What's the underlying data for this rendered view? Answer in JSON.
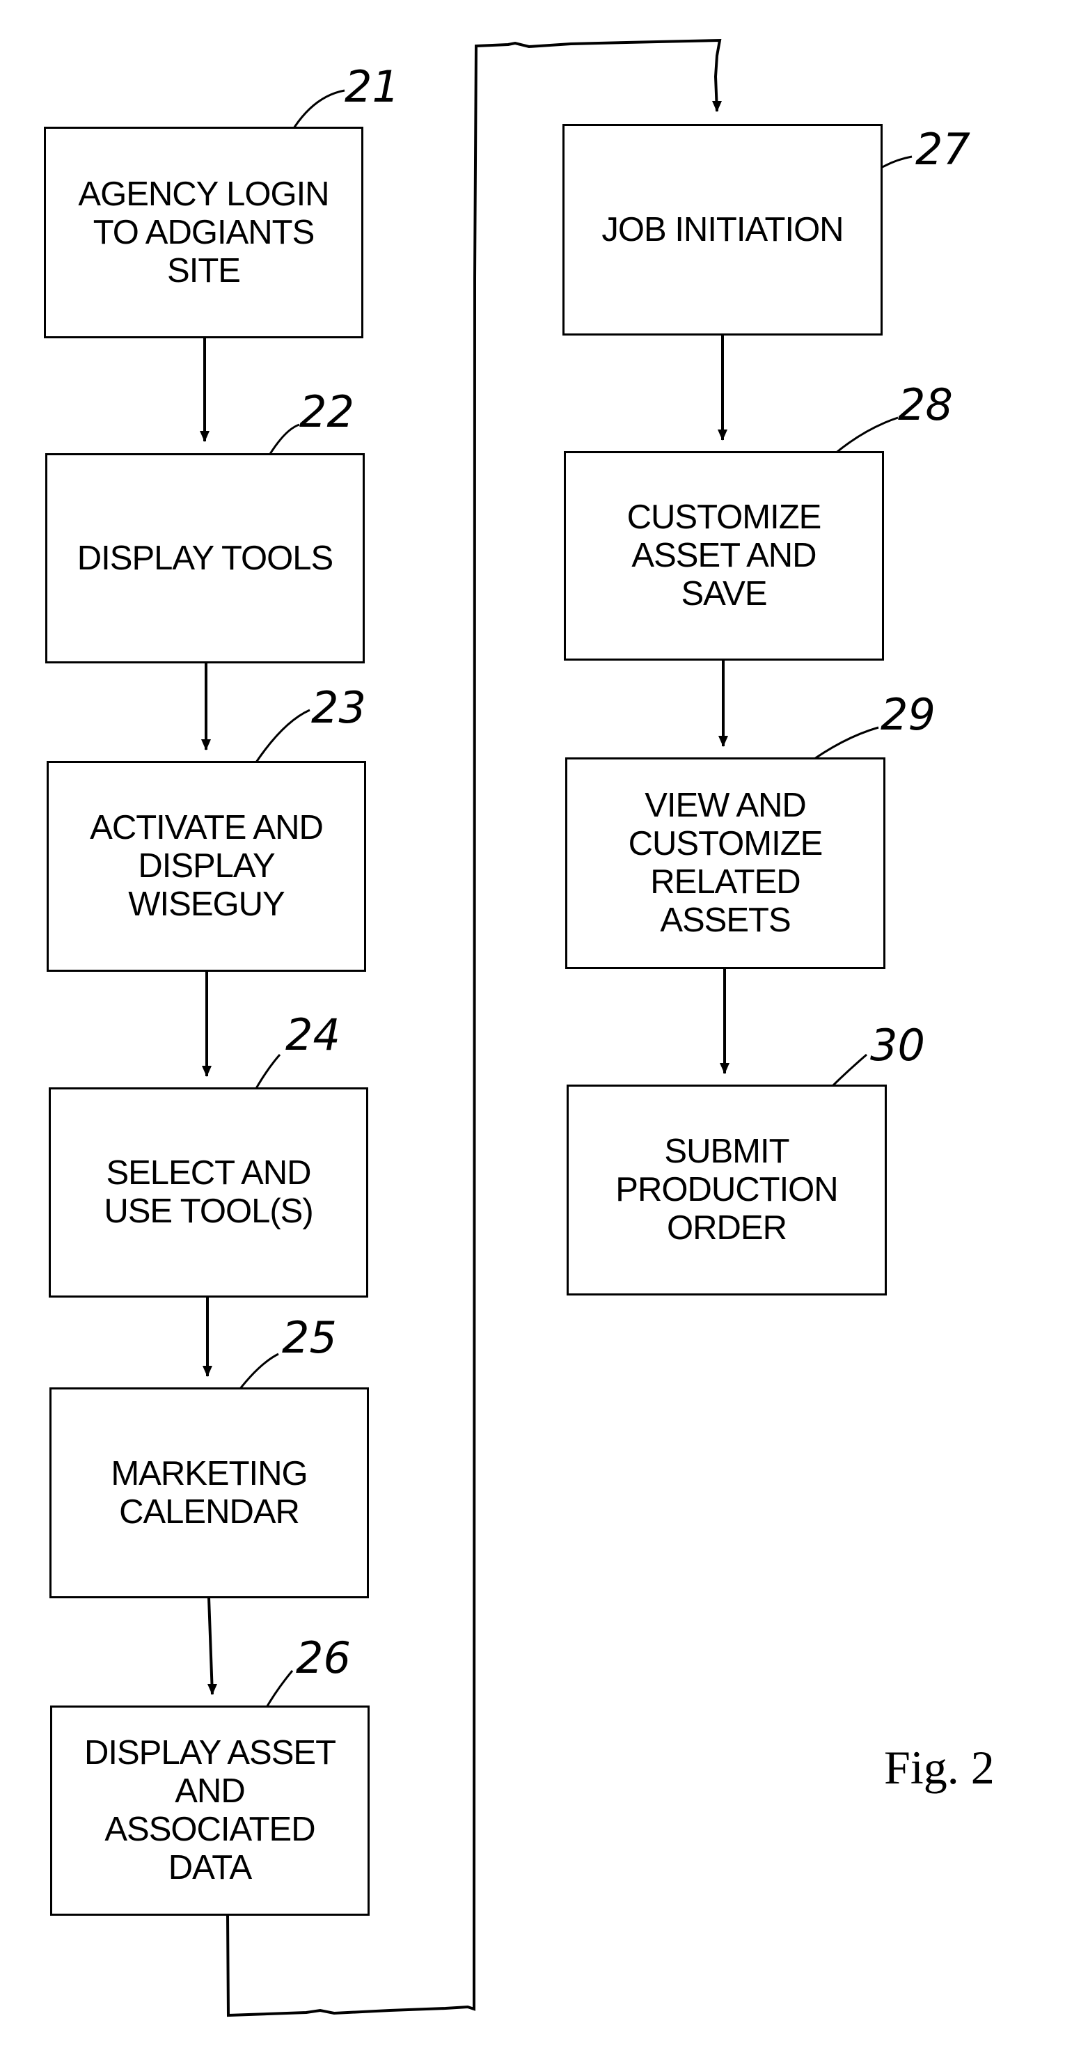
{
  "figure": {
    "label": "Fig. 2",
    "steps": [
      {
        "ref": "21",
        "text": "AGENCY LOGIN\nTO ADGIANTS\nSITE"
      },
      {
        "ref": "22",
        "text": "DISPLAY TOOLS"
      },
      {
        "ref": "23",
        "text": "ACTIVATE AND\nDISPLAY\nWISEGUY"
      },
      {
        "ref": "24",
        "text": "SELECT AND\nUSE TOOL(S)"
      },
      {
        "ref": "25",
        "text": "MARKETING\nCALENDAR"
      },
      {
        "ref": "26",
        "text": "DISPLAY ASSET\nAND\nASSOCIATED\nDATA"
      },
      {
        "ref": "27",
        "text": "JOB INITIATION"
      },
      {
        "ref": "28",
        "text": "CUSTOMIZE\nASSET AND\nSAVE"
      },
      {
        "ref": "29",
        "text": "VIEW AND\nCUSTOMIZE\nRELATED\nASSETS"
      },
      {
        "ref": "30",
        "text": "SUBMIT\nPRODUCTION\nORDER"
      }
    ],
    "flow": [
      "21",
      "22",
      "23",
      "24",
      "25",
      "26",
      "27",
      "28",
      "29",
      "30"
    ]
  }
}
